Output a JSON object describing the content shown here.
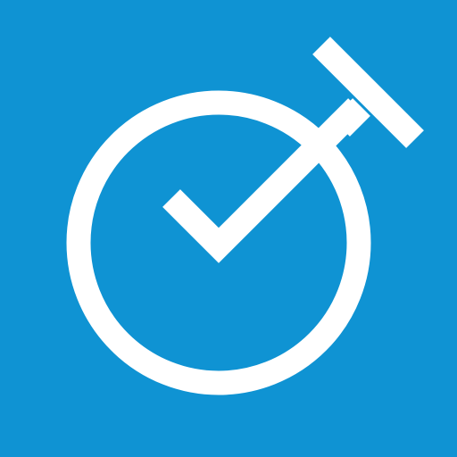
{
  "app_icon": {
    "name": "timer-check-app-icon",
    "background_color": "#0f93d3",
    "foreground_color": "#ffffff",
    "icon_semantic": "stopwatch-with-checkmark-icon",
    "parts": {
      "ring": "stopwatch-ring-icon",
      "check": "checkmark-icon",
      "stem": "stopwatch-stem-icon",
      "crown": "stopwatch-crown-icon"
    }
  }
}
